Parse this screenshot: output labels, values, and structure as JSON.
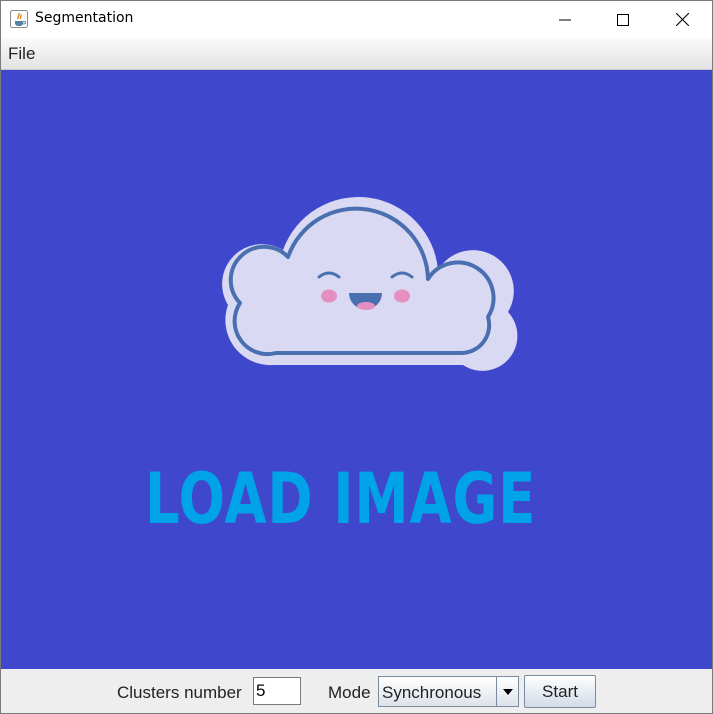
{
  "window": {
    "title": "Segmentation",
    "icon": "java-icon",
    "controls": [
      "minimize-icon",
      "maximize-icon",
      "close-icon"
    ]
  },
  "menu": {
    "file_label": "File"
  },
  "canvas": {
    "placeholder_text": "LOAD IMAGE",
    "placeholder_graphic": "smiling-cloud",
    "background_color": "#3f47cc",
    "text_color": "#00a2e8"
  },
  "controls": {
    "clusters_label": "Clusters number",
    "clusters_value": "5",
    "mode_label": "Mode",
    "mode_value": "Synchronous",
    "start_label": "Start"
  }
}
